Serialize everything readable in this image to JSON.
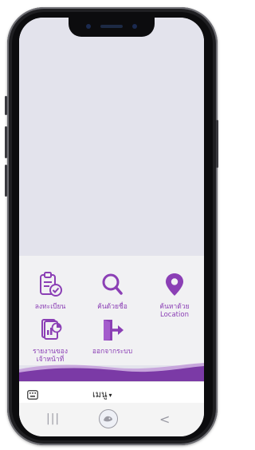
{
  "colors": {
    "accent": "#8b3fb5",
    "wave_dark": "#7b3aa6",
    "wave_light": "#c7a6dc",
    "screen_bg": "#e3e3ec",
    "panel_bg": "#f1f1f3"
  },
  "menu": {
    "items": [
      {
        "label": "ลงทะเบียน",
        "icon": "clipboard-check-icon"
      },
      {
        "label": "ค้นด้วยชื่อ",
        "icon": "search-icon"
      },
      {
        "label": "ค้นหาด้วย\nLocation",
        "icon": "location-pin-icon"
      },
      {
        "label": "รายงานของ\nเจ้าหน้าที่",
        "icon": "report-chart-icon"
      },
      {
        "label": "ออกจากระบบ",
        "icon": "logout-door-icon"
      }
    ]
  },
  "bottom_bar": {
    "keyboard_icon": "keyboard-icon",
    "menu_label": "เมนู",
    "caret": "▾"
  },
  "nav": {
    "recents": "|||",
    "back": "<"
  }
}
